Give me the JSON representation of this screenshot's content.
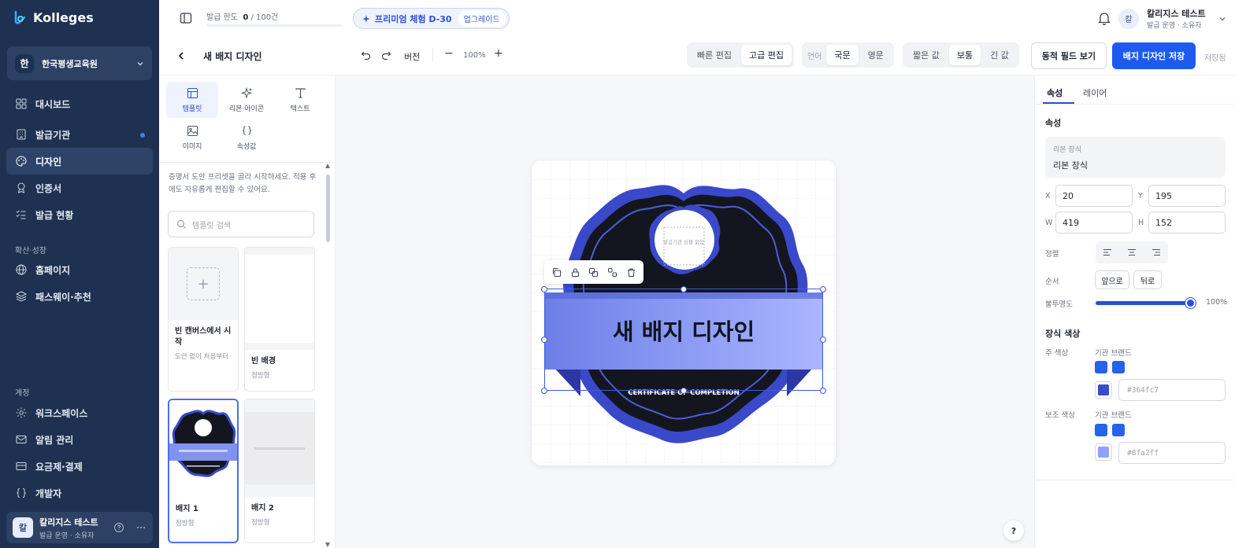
{
  "app": {
    "name": "Kolleges"
  },
  "sidebar": {
    "org": {
      "badge": "한",
      "name": "한국평생교육원"
    },
    "items": [
      {
        "label": "대시보드",
        "icon": "grid-icon"
      },
      {
        "label": "발급기관",
        "icon": "building-icon"
      },
      {
        "label": "디자인",
        "icon": "palette-icon",
        "active": true
      },
      {
        "label": "인증서",
        "icon": "award-icon"
      },
      {
        "label": "발급 현황",
        "icon": "list-check-icon"
      }
    ],
    "group_growth": "확산·성장",
    "growth_items": [
      {
        "label": "홈페이지",
        "icon": "globe-icon"
      },
      {
        "label": "패스웨이·추천",
        "icon": "layers-icon"
      }
    ],
    "group_account": "계정",
    "account_items": [
      {
        "label": "워크스페이스",
        "icon": "gear-icon"
      },
      {
        "label": "알림 관리",
        "icon": "mail-icon"
      },
      {
        "label": "요금제·결제",
        "icon": "card-icon"
      },
      {
        "label": "개발자",
        "icon": "braces-icon"
      }
    ],
    "user": {
      "avatar": "칼",
      "name": "칼리지스 테스트",
      "role": "발급 운영 · 소유자"
    }
  },
  "topbar": {
    "quota_label": "발급 한도",
    "quota_value": "0",
    "quota_total": "/ 100건",
    "quota_progress": 0,
    "premium_label": "프리미엄 체험 D-30",
    "upgrade_label": "업그레이드",
    "user": {
      "avatar": "칼",
      "name": "칼리지스 테스트",
      "role": "발급 운영 · 소유자"
    }
  },
  "toolbar": {
    "title": "새 배지 디자인",
    "version_label": "버전",
    "zoom": "100%",
    "edit_modes": [
      "빠른 편집",
      "고급 편집"
    ],
    "edit_mode_selected": "고급 편집",
    "language_label": "언어",
    "languages": [
      "국문",
      "영문"
    ],
    "language_selected": "국문",
    "lengths": [
      "짧은 값",
      "보통",
      "긴 값"
    ],
    "length_selected": "보통",
    "dynamic_fields_label": "동적 필드 보기",
    "save_label": "배지 디자인 저장",
    "saved_status": "저장됨"
  },
  "leftpanel": {
    "tools": [
      {
        "label": "템플릿",
        "icon": "template-icon",
        "active": true
      },
      {
        "label": "리본·아이콘",
        "icon": "sparkle-icon"
      },
      {
        "label": "텍스트",
        "icon": "text-icon"
      },
      {
        "label": "이미지",
        "icon": "image-icon"
      },
      {
        "label": "속성값",
        "icon": "braces-icon"
      }
    ],
    "description": "증명서 도안 프리셋을 골라 시작하세요. 적용 후에도 자유롭게 편집할 수 있어요.",
    "search_placeholder": "템플릿 검색",
    "templates": [
      {
        "name": "빈 캔버스에서 시작",
        "sub": "도안 없이 처음부터"
      },
      {
        "name": "빈 배경",
        "sub": "정방형"
      },
      {
        "name": "배지 1",
        "sub": "정방형",
        "selected": true
      },
      {
        "name": "배지 2",
        "sub": "정방형"
      }
    ]
  },
  "canvas": {
    "badge_title": "새 배지 디자인",
    "badge_subtitle": "CERTIFICATE OF COMPLETION",
    "logo_placeholder": "발급기관 심볼 없음",
    "help_label": "?"
  },
  "rightpanel": {
    "tabs": [
      "속성",
      "레이어"
    ],
    "tab_selected": "속성",
    "section_title": "속성",
    "element_type_label": "리본 장식",
    "element_type_value": "리본 장식",
    "x_label": "X",
    "x_value": "20",
    "y_label": "Y",
    "y_value": "195",
    "w_label": "W",
    "w_value": "419",
    "h_label": "H",
    "h_value": "152",
    "align_label": "정렬",
    "order_label": "순서",
    "order_front": "앞으로",
    "order_back": "뒤로",
    "opacity_label": "불투명도",
    "opacity_value": "100%",
    "opacity_fraction": 1.0,
    "deco_color_title": "장식 색상",
    "primary_label": "주 색상",
    "primary_brand_label": "기관 브랜드",
    "primary_hex": "#364fc7",
    "secondary_label": "보조 색상",
    "secondary_brand_label": "기관 브랜드",
    "secondary_hex": "#8fa2ff"
  },
  "colors": {
    "sidebar_bg": "#1e3150",
    "accent": "#1f5af0",
    "brand_swatch": "#2563eb",
    "badge_dark": "#14161f",
    "badge_ring": "#3a49c9"
  }
}
